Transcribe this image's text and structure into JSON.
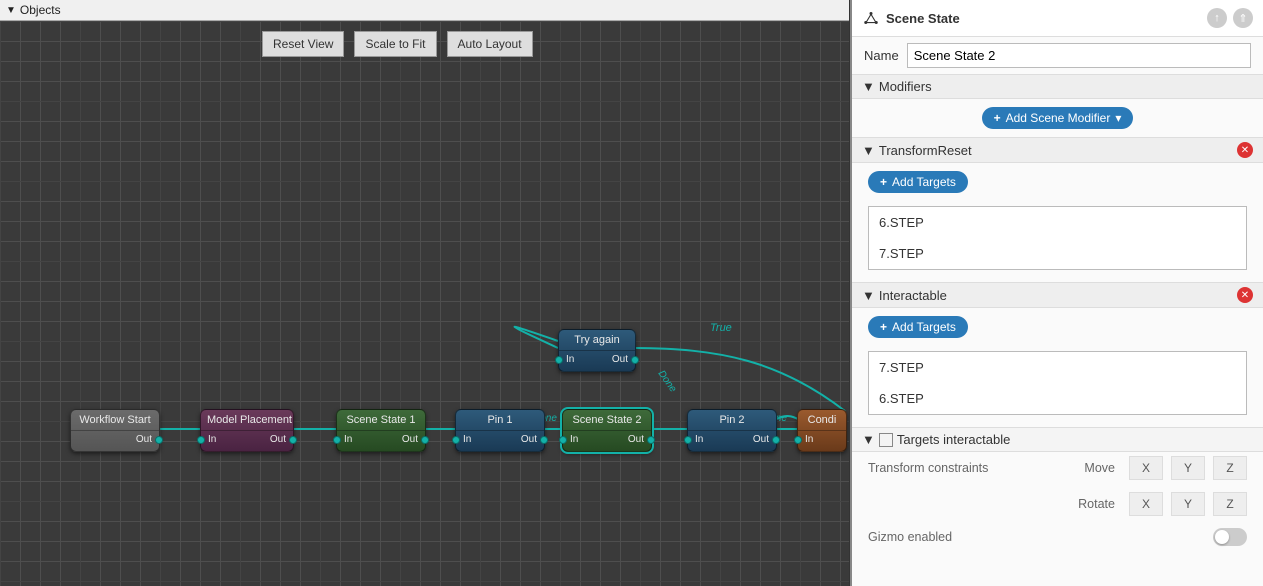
{
  "canvas": {
    "header": "Objects",
    "toolbar": {
      "reset": "Reset View",
      "scale": "Scale to Fit",
      "auto": "Auto Layout"
    },
    "edge_labels": {
      "true": "True",
      "done1": "Done",
      "done2": "Done",
      "done3": "Done"
    },
    "nodes": {
      "start": {
        "title": "Workflow Start",
        "out": "Out"
      },
      "model": {
        "title": "Model Placement",
        "in": "In",
        "out": "Out"
      },
      "ss1": {
        "title": "Scene State 1",
        "in": "In",
        "out": "Out"
      },
      "pin1": {
        "title": "Pin 1",
        "in": "In",
        "out": "Out"
      },
      "ss2": {
        "title": "Scene State 2",
        "in": "In",
        "out": "Out"
      },
      "pin2": {
        "title": "Pin 2",
        "in": "In",
        "out": "Out"
      },
      "cond": {
        "title": "Condi",
        "in": "In"
      },
      "retry": {
        "title": "Try again",
        "in": "In",
        "out": "Out"
      }
    }
  },
  "panel": {
    "title": "Scene State",
    "name_label": "Name",
    "name_value": "Scene State 2",
    "modifiers_label": "Modifiers",
    "add_modifier": "Add Scene Modifier",
    "sections": {
      "transform_reset": {
        "label": "TransformReset",
        "add_targets": "Add Targets",
        "items": [
          "6.STEP",
          "7.STEP"
        ]
      },
      "interactable": {
        "label": "Interactable",
        "add_targets": "Add Targets",
        "items": [
          "7.STEP",
          "6.STEP"
        ],
        "targets_checkbox_label": "Targets interactable",
        "transform_constraints": "Transform constraints",
        "move": "Move",
        "rotate": "Rotate",
        "axes": {
          "x": "X",
          "y": "Y",
          "z": "Z"
        },
        "gizmo": "Gizmo enabled"
      }
    }
  }
}
